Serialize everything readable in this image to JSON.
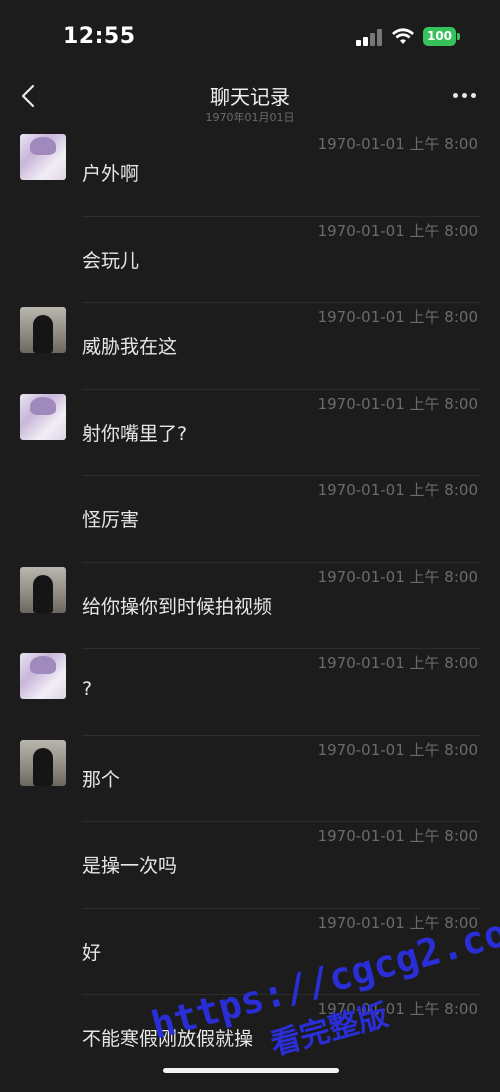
{
  "status_bar": {
    "time": "12:55",
    "battery": "100"
  },
  "header": {
    "title": "聊天记录",
    "subtitle": "1970年01月01日"
  },
  "messages": [
    {
      "avatar": "boy",
      "time": "1970-01-01 上午 8:00",
      "text": "户外啊"
    },
    {
      "avatar": "",
      "time": "1970-01-01 上午 8:00",
      "text": "会玩儿"
    },
    {
      "avatar": "girl",
      "time": "1970-01-01 上午 8:00",
      "text": "威胁我在这"
    },
    {
      "avatar": "boy",
      "time": "1970-01-01 上午 8:00",
      "text": "射你嘴里了?"
    },
    {
      "avatar": "",
      "time": "1970-01-01 上午 8:00",
      "text": "怪厉害"
    },
    {
      "avatar": "girl",
      "time": "1970-01-01 上午 8:00",
      "text": "给你操你到时候拍视频"
    },
    {
      "avatar": "boy",
      "time": "1970-01-01 上午 8:00",
      "text": "?"
    },
    {
      "avatar": "girl",
      "time": "1970-01-01 上午 8:00",
      "text": "那个"
    },
    {
      "avatar": "",
      "time": "1970-01-01 上午 8:00",
      "text": "是操一次吗"
    },
    {
      "avatar": "",
      "time": "1970-01-01 上午 8:00",
      "text": "好"
    },
    {
      "avatar": "",
      "time": "1970-01-01 上午 8:00",
      "text": "不能寒假刚放假就操"
    }
  ],
  "watermark": {
    "url": "https://cgcg2.co",
    "text": "看完整版"
  },
  "colors": {
    "background": "#1c1c1c",
    "battery": "#36c15a",
    "watermark": "#2a2ed6"
  }
}
